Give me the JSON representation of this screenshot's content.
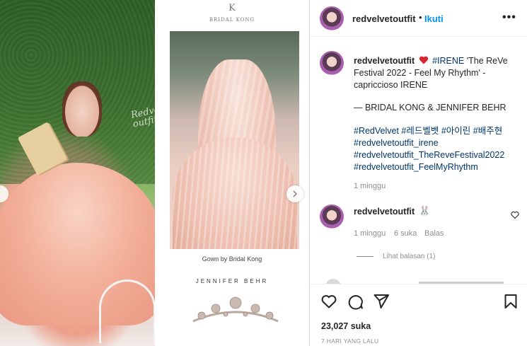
{
  "media": {
    "watermark": "Redvelvet outfit",
    "brand_logo": "K",
    "brand_name": "BRIDAL KONG",
    "gown_caption": "Gown by Bridal Kong",
    "designer_name": "JENNIFER BEHR"
  },
  "header": {
    "username": "redvelvetoutfit",
    "separator": "•",
    "follow_label": "Ikuti",
    "more_icon": "more-horizontal-icon"
  },
  "caption": {
    "username": "redvelvetoutfit",
    "tag_irene": "#IRENE",
    "text_line1": "'The ReVe Festival 2022 - Feel My Rhythm' - capriccioso IRENE",
    "credit": "— BRIDAL KONG & JENNIFER BEHR",
    "hashtags": "#RedVelvet #레드벨벳 #아이린 #배주현 #redvelvetoutfit_irene #redvelvetoutfit_TheReveFestival2022 #redvelvetoutfit_FeelMyRhythm",
    "time": "1 minggu"
  },
  "comment": {
    "username": "redvelvetoutfit",
    "emoji": "🐰",
    "time": "1 minggu",
    "likes": "6 suka",
    "reply_label": "Balas",
    "view_replies": "Lihat balasan (1)"
  },
  "actions": {
    "likes_count": "23,027 suka",
    "posted": "7 HARI YANG LALU"
  },
  "colors": {
    "accent": "#0095f6",
    "hashtag": "#00376b",
    "muted": "#8e8e8e",
    "text": "#262626",
    "heart_red": "#ed4956"
  }
}
